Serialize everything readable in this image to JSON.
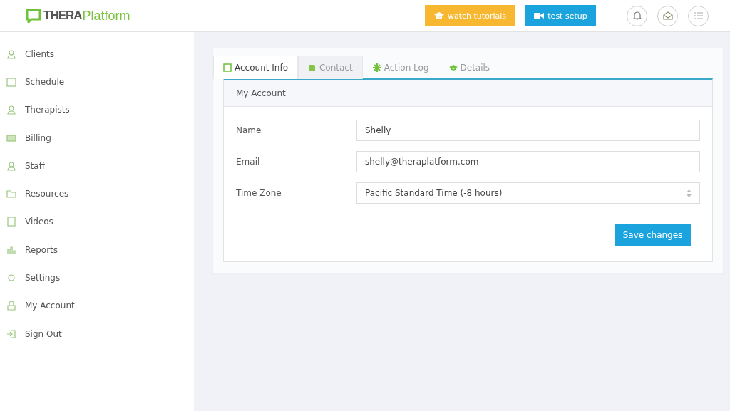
{
  "header": {
    "logo": {
      "dark": "THERA",
      "light": "Platform"
    },
    "buttons": [
      {
        "label": "watch tutorials",
        "kind": "tutorials"
      },
      {
        "label": "test setup",
        "kind": "setup"
      }
    ]
  },
  "sidebar": {
    "items": [
      {
        "label": "Clients",
        "selected": false
      },
      {
        "label": "Schedule",
        "selected": false
      },
      {
        "label": "Therapists",
        "selected": false
      },
      {
        "label": "Billing",
        "selected": false
      },
      {
        "label": "Staff",
        "selected": false
      },
      {
        "label": "Resources",
        "selected": false
      },
      {
        "label": "Videos",
        "selected": false
      },
      {
        "label": "Reports",
        "selected": false
      },
      {
        "label": "Settings",
        "selected": false
      },
      {
        "label": "My Account",
        "selected": false
      },
      {
        "label": "Sign Out",
        "selected": false
      }
    ]
  },
  "tabs": [
    {
      "label": "Account Info",
      "selected": true,
      "hovered": false
    },
    {
      "label": "Contact",
      "selected": false,
      "hovered": true
    },
    {
      "label": "Action Log",
      "selected": false,
      "hovered": false
    },
    {
      "label": "Details",
      "selected": false,
      "hovered": false
    }
  ],
  "panel": {
    "title": "My Account",
    "fields": [
      {
        "label": "Name",
        "value": "Shelly",
        "kind": "text"
      },
      {
        "label": "Email",
        "value": "shelly@theraplatform.com",
        "kind": "text"
      },
      {
        "label": "Time Zone",
        "value": "Pacific Standard Time (-8 hours)",
        "kind": "select"
      }
    ],
    "save_button": "Save changes"
  }
}
